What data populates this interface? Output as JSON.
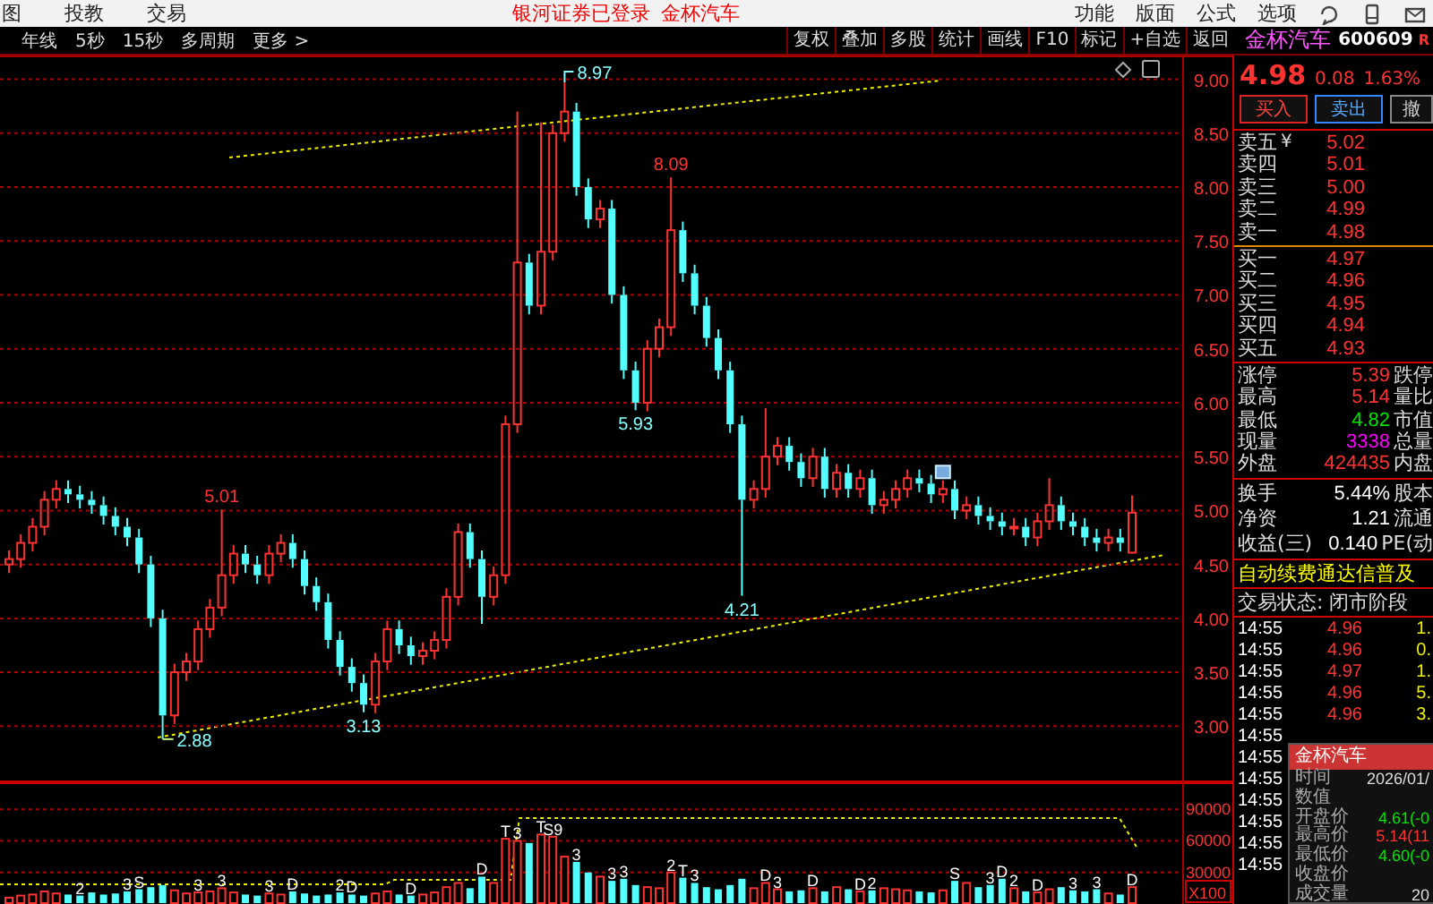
{
  "menu_bar": {
    "items": [
      "图",
      "投教",
      "交易"
    ],
    "login_status": "银河证券已登录",
    "stock_name": "金杯汽车",
    "right_items": [
      "功能",
      "版面",
      "公式",
      "选项"
    ]
  },
  "period_bar": {
    "items": [
      "年线",
      "5秒",
      "15秒",
      "多周期",
      "更多 >"
    ]
  },
  "tool_buttons": [
    "复权",
    "叠加",
    "多股",
    "统计",
    "画线",
    "F10",
    "标记",
    "+自选",
    "返回"
  ],
  "stock": {
    "name": "金杯汽车",
    "code": "600609",
    "badge": "R"
  },
  "price_chart": {
    "chart_data": {
      "type": "candlestick",
      "ohlc": [
        [
          4.5,
          4.63,
          4.42,
          4.55
        ],
        [
          4.55,
          4.78,
          4.47,
          4.7
        ],
        [
          4.7,
          4.93,
          4.62,
          4.85
        ],
        [
          4.85,
          5.18,
          4.77,
          5.1
        ],
        [
          5.1,
          5.28,
          5.02,
          5.2
        ],
        [
          5.2,
          5.28,
          5.07,
          5.15
        ],
        [
          5.15,
          5.23,
          5.02,
          5.1
        ],
        [
          5.1,
          5.18,
          4.97,
          5.05
        ],
        [
          5.05,
          5.13,
          4.87,
          4.95
        ],
        [
          4.95,
          5.03,
          4.77,
          4.85
        ],
        [
          4.85,
          4.93,
          4.67,
          4.75
        ],
        [
          4.75,
          4.83,
          4.42,
          4.5
        ],
        [
          4.5,
          4.58,
          3.92,
          4.0
        ],
        [
          4.0,
          4.08,
          2.88,
          3.1
        ],
        [
          3.1,
          3.58,
          3.02,
          3.5
        ],
        [
          3.5,
          3.68,
          3.42,
          3.6
        ],
        [
          3.6,
          3.98,
          3.52,
          3.9
        ],
        [
          3.9,
          4.18,
          3.82,
          4.1
        ],
        [
          4.1,
          5.01,
          4.02,
          4.4
        ],
        [
          4.4,
          4.68,
          4.32,
          4.6
        ],
        [
          4.6,
          4.68,
          4.42,
          4.5
        ],
        [
          4.5,
          4.58,
          4.32,
          4.4
        ],
        [
          4.4,
          4.68,
          4.32,
          4.6
        ],
        [
          4.6,
          4.78,
          4.52,
          4.7
        ],
        [
          4.7,
          4.78,
          4.47,
          4.55
        ],
        [
          4.55,
          4.63,
          4.22,
          4.3
        ],
        [
          4.3,
          4.38,
          4.07,
          4.15
        ],
        [
          4.15,
          4.23,
          3.72,
          3.8
        ],
        [
          3.8,
          3.88,
          3.47,
          3.55
        ],
        [
          3.55,
          3.63,
          3.32,
          3.4
        ],
        [
          3.4,
          3.48,
          3.13,
          3.2
        ],
        [
          3.2,
          3.68,
          3.12,
          3.6
        ],
        [
          3.6,
          3.98,
          3.52,
          3.9
        ],
        [
          3.9,
          3.98,
          3.67,
          3.75
        ],
        [
          3.75,
          3.83,
          3.57,
          3.65
        ],
        [
          3.65,
          3.78,
          3.57,
          3.7
        ],
        [
          3.7,
          3.88,
          3.62,
          3.8
        ],
        [
          3.8,
          4.28,
          3.72,
          4.2
        ],
        [
          4.2,
          4.88,
          4.12,
          4.8
        ],
        [
          4.8,
          4.88,
          4.47,
          4.55
        ],
        [
          4.55,
          4.63,
          3.95,
          4.2
        ],
        [
          4.2,
          4.48,
          4.12,
          4.4
        ],
        [
          4.4,
          5.88,
          4.32,
          5.8
        ],
        [
          5.8,
          8.7,
          5.72,
          7.3
        ],
        [
          7.3,
          7.38,
          6.82,
          6.9
        ],
        [
          6.9,
          8.6,
          6.82,
          7.4
        ],
        [
          7.4,
          8.58,
          7.32,
          8.5
        ],
        [
          8.5,
          8.97,
          8.42,
          8.7
        ],
        [
          8.7,
          8.78,
          7.92,
          8.0
        ],
        [
          8.0,
          8.08,
          7.62,
          7.7
        ],
        [
          7.7,
          7.88,
          7.62,
          7.8
        ],
        [
          7.8,
          7.88,
          6.92,
          7.0
        ],
        [
          7.0,
          7.08,
          6.22,
          6.3
        ],
        [
          6.3,
          6.38,
          5.93,
          6.0
        ],
        [
          6.0,
          6.58,
          5.92,
          6.5
        ],
        [
          6.5,
          6.78,
          6.42,
          6.7
        ],
        [
          6.7,
          8.09,
          6.62,
          7.6
        ],
        [
          7.6,
          7.68,
          7.12,
          7.2
        ],
        [
          7.2,
          7.28,
          6.82,
          6.9
        ],
        [
          6.9,
          6.98,
          6.52,
          6.6
        ],
        [
          6.6,
          6.68,
          6.22,
          6.3
        ],
        [
          6.3,
          6.38,
          5.72,
          5.8
        ],
        [
          5.8,
          5.88,
          4.21,
          5.1
        ],
        [
          5.1,
          5.28,
          5.02,
          5.2
        ],
        [
          5.2,
          5.95,
          5.12,
          5.5
        ],
        [
          5.5,
          5.68,
          5.42,
          5.6
        ],
        [
          5.6,
          5.68,
          5.37,
          5.45
        ],
        [
          5.45,
          5.53,
          5.22,
          5.3
        ],
        [
          5.3,
          5.58,
          5.22,
          5.5
        ],
        [
          5.5,
          5.58,
          5.12,
          5.2
        ],
        [
          5.2,
          5.43,
          5.12,
          5.35
        ],
        [
          5.35,
          5.43,
          5.12,
          5.2
        ],
        [
          5.2,
          5.38,
          5.12,
          5.3
        ],
        [
          5.3,
          5.38,
          4.97,
          5.05
        ],
        [
          5.05,
          5.18,
          4.97,
          5.1
        ],
        [
          5.1,
          5.28,
          5.02,
          5.2
        ],
        [
          5.2,
          5.38,
          5.12,
          5.3
        ],
        [
          5.3,
          5.38,
          5.17,
          5.25
        ],
        [
          5.25,
          5.33,
          5.07,
          5.15
        ],
        [
          5.15,
          5.28,
          5.07,
          5.2
        ],
        [
          5.2,
          5.28,
          4.92,
          5.0
        ],
        [
          5.0,
          5.13,
          4.92,
          5.05
        ],
        [
          5.05,
          5.13,
          4.87,
          4.95
        ],
        [
          4.95,
          5.03,
          4.82,
          4.9
        ],
        [
          4.9,
          4.98,
          4.77,
          4.85
        ],
        [
          4.85,
          4.93,
          4.77,
          4.85
        ],
        [
          4.85,
          4.93,
          4.67,
          4.75
        ],
        [
          4.75,
          4.98,
          4.67,
          4.9
        ],
        [
          4.9,
          5.3,
          4.82,
          5.05
        ],
        [
          5.05,
          5.13,
          4.82,
          4.9
        ],
        [
          4.9,
          4.98,
          4.77,
          4.85
        ],
        [
          4.85,
          4.93,
          4.67,
          4.75
        ],
        [
          4.75,
          4.83,
          4.62,
          4.7
        ],
        [
          4.7,
          4.83,
          4.62,
          4.75
        ],
        [
          4.75,
          4.83,
          4.62,
          4.7
        ],
        [
          4.61,
          5.14,
          4.6,
          4.98
        ]
      ],
      "yticks": [
        {
          "value": 9,
          "label": "9.00"
        },
        {
          "value": 8.5,
          "label": "8.50"
        },
        {
          "value": 8,
          "label": "8.00"
        },
        {
          "value": 7.5,
          "label": "7.50"
        },
        {
          "value": 7,
          "label": "7.00"
        },
        {
          "value": 6.5,
          "label": "6.50"
        },
        {
          "value": 6,
          "label": "6.00"
        },
        {
          "value": 5.5,
          "label": "5.50"
        },
        {
          "value": 5,
          "label": "5.00"
        },
        {
          "value": 4.5,
          "label": "4.50"
        },
        {
          "value": 4,
          "label": "4.00"
        },
        {
          "value": 3.5,
          "label": "3.50"
        },
        {
          "value": 3,
          "label": "3.00"
        }
      ],
      "ylim": [
        2.48,
        9.22
      ],
      "grid": true,
      "annotations": [
        "8.97",
        "8.09",
        "5.93",
        "5.01",
        "3.13",
        "2.88",
        "4.21"
      ]
    }
  },
  "volume_chart": {
    "unit": "X100",
    "chart_data": {
      "type": "bar",
      "values": [
        6000,
        8000,
        9000,
        12000,
        10000,
        9000,
        8000,
        11000,
        9000,
        10000,
        12000,
        14000,
        16000,
        18000,
        13000,
        10000,
        11000,
        12000,
        15000,
        11000,
        9000,
        8000,
        10000,
        9000,
        12000,
        10000,
        8000,
        9000,
        11000,
        9000,
        8000,
        10000,
        12000,
        9000,
        8000,
        9000,
        11000,
        16000,
        20000,
        15000,
        26000,
        20000,
        62000,
        60000,
        58000,
        66000,
        64000,
        45000,
        40000,
        30000,
        26000,
        22000,
        24000,
        18000,
        16000,
        15000,
        30000,
        25000,
        20000,
        16000,
        14000,
        18000,
        24000,
        15000,
        20000,
        14000,
        12000,
        13000,
        15000,
        12000,
        16000,
        14000,
        12000,
        13000,
        15000,
        14000,
        13000,
        12000,
        11000,
        13000,
        22000,
        20000,
        16000,
        18000,
        24000,
        15000,
        12000,
        11000,
        14000,
        16000,
        13000,
        12000,
        14000,
        10000,
        9000,
        16000
      ],
      "yticks": [
        {
          "value": 90000,
          "label": "90000"
        },
        {
          "value": 60000,
          "label": "60000"
        },
        {
          "value": 30000,
          "label": "30000"
        }
      ],
      "ylim": [
        0,
        115714
      ],
      "grid": true,
      "annotations": [
        "2",
        "3",
        "S",
        "3",
        "3",
        "3",
        "D",
        "2",
        "D",
        "D",
        "D",
        "T",
        "3",
        "T",
        "S9",
        "3",
        "3",
        "3",
        "2",
        "T",
        "3",
        "D",
        "3",
        "D",
        "D",
        "2",
        "S",
        "3",
        "D",
        "2",
        "D",
        "3",
        "3",
        "D"
      ]
    }
  },
  "quote": {
    "price": "4.98",
    "change": "0.08",
    "change_pct": "1.63%"
  },
  "trade_buttons": [
    {
      "label": "买入",
      "kind": "buy"
    },
    {
      "label": "卖出",
      "kind": "sell"
    },
    {
      "label": "撤",
      "kind": "cancel"
    }
  ],
  "sell_book": [
    {
      "label": "卖五",
      "badge": "¥",
      "price": "5.02"
    },
    {
      "label": "卖四",
      "price": "5.01"
    },
    {
      "label": "卖三",
      "price": "5.00"
    },
    {
      "label": "卖二",
      "price": "4.99"
    },
    {
      "label": "卖一",
      "price": "4.98"
    }
  ],
  "buy_book": [
    {
      "label": "买一",
      "price": "4.97"
    },
    {
      "label": "买二",
      "price": "4.96"
    },
    {
      "label": "买三",
      "price": "4.95"
    },
    {
      "label": "买四",
      "price": "4.94"
    },
    {
      "label": "买五",
      "price": "4.93"
    }
  ],
  "stats": [
    {
      "label": "涨停",
      "value": "5.39",
      "color": "#ff3232",
      "label_2": "跌停"
    },
    {
      "label": "最高",
      "value": "5.14",
      "color": "#ff3232",
      "label_2": "量比"
    },
    {
      "label": "最低",
      "value": "4.82",
      "color": "#00e600",
      "label_2": "市值"
    },
    {
      "label": "现量",
      "value": "3338",
      "color": "#ff00ff",
      "label_2": "总量"
    },
    {
      "label": "外盘",
      "value": "424435",
      "color": "#ff3232",
      "label_2": "内盘"
    }
  ],
  "fundamentals": [
    {
      "label": "换手",
      "value": "5.44%",
      "label_2": "股本"
    },
    {
      "label": "净资",
      "value": "1.21",
      "label_2": "流通"
    },
    {
      "label": "收益(三)",
      "value": "0.140",
      "label_2": "PE(动"
    }
  ],
  "ticker": "自动续费通达信普及",
  "trade_status": "交易状态: 闭市阶段",
  "trades": [
    {
      "time": "14:55",
      "price": "4.96",
      "volume": "1."
    },
    {
      "time": "14:55",
      "price": "4.96",
      "volume": "0."
    },
    {
      "time": "14:55",
      "price": "4.97",
      "volume": "1."
    },
    {
      "time": "14:55",
      "price": "4.96",
      "volume": "5."
    },
    {
      "time": "14:55",
      "price": "4.96",
      "volume": "3."
    },
    {
      "time": "14:55"
    },
    {
      "time": "14:55"
    },
    {
      "time": "14:55"
    },
    {
      "time": "14:55"
    },
    {
      "time": "14:55"
    },
    {
      "time": "14:55"
    },
    {
      "time": "14:55"
    }
  ],
  "tooltip": {
    "title": "金杯汽车",
    "rows": [
      {
        "label": "时间",
        "value": "2026/01/"
      },
      {
        "label": "数值"
      },
      {
        "label": "开盘价",
        "value": "4.61(-0",
        "color": "#00e600"
      },
      {
        "label": "最高价",
        "value": "5.14(11",
        "color": "#ff3232"
      },
      {
        "label": "最低价",
        "value": "4.60(-0",
        "color": "#00e600"
      },
      {
        "label": "收盘价"
      },
      {
        "label": "成交量",
        "value": "20"
      }
    ]
  }
}
